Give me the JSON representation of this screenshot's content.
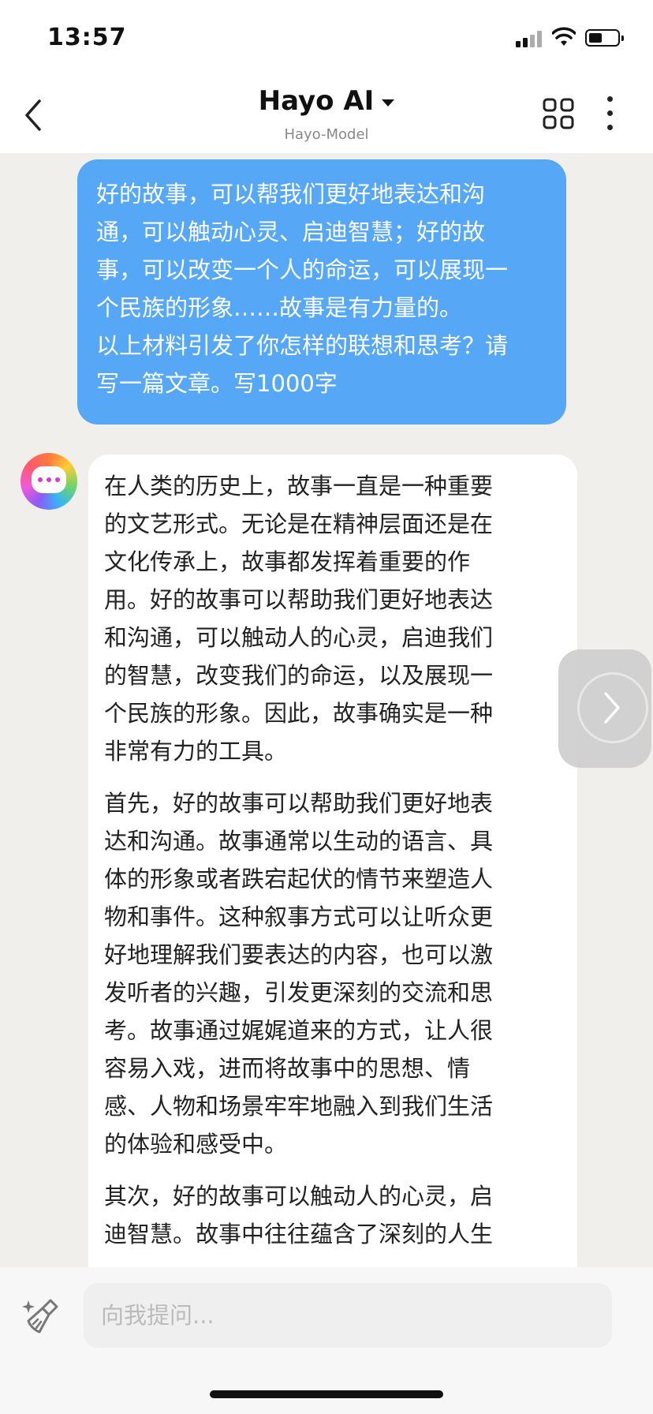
{
  "status_bar": {
    "time": "13:57"
  },
  "header": {
    "title": "Hayo AI",
    "subtitle": "Hayo-Model",
    "icons": [
      "back-icon",
      "chevron-down-icon",
      "grid-icon",
      "more-vertical-icon"
    ]
  },
  "messages": {
    "user": {
      "lines": [
        "好的故事，可以帮我们更好地表达和沟",
        "通，可以触动心灵、启迪智慧；好的故",
        "事，可以改变一个人的命运，可以展现一",
        "个民族的形象……故事是有力量的。",
        "以上材料引发了你怎样的联想和思考？请",
        "写一篇文章。写1000字"
      ]
    },
    "ai": {
      "paragraphs": [
        [
          "在人类的历史上，故事一直是一种重要",
          "的文艺形式。无论是在精神层面还是在",
          "文化传承上，故事都发挥着重要的作",
          "用。好的故事可以帮助我们更好地表达",
          "和沟通，可以触动人的心灵，启迪我们",
          "的智慧，改变我们的命运，以及展现一",
          "个民族的形象。因此，故事确实是一种",
          "非常有力的工具。"
        ],
        [
          "首先，好的故事可以帮助我们更好地表",
          "达和沟通。故事通常以生动的语言、具",
          "体的形象或者跌宕起伏的情节来塑造人",
          "物和事件。这种叙事方式可以让听众更",
          "好地理解我们要表达的内容，也可以激",
          "发听者的兴趣，引发更深刻的交流和思",
          "考。故事通过娓娓道来的方式，让人很",
          "容易入戏，进而将故事中的思想、情",
          "感、人物和场景牢牢地融入到我们生活",
          "的体验和感受中。"
        ],
        [
          "其次，好的故事可以触动人的心灵，启",
          "迪智慧。故事中往往蕴含了深刻的人生"
        ]
      ]
    }
  },
  "input": {
    "placeholder": "向我提问..."
  },
  "colors": {
    "user_bubble": "#56a7f5",
    "background": "#f0efeb",
    "ai_bubble": "#ffffff"
  }
}
